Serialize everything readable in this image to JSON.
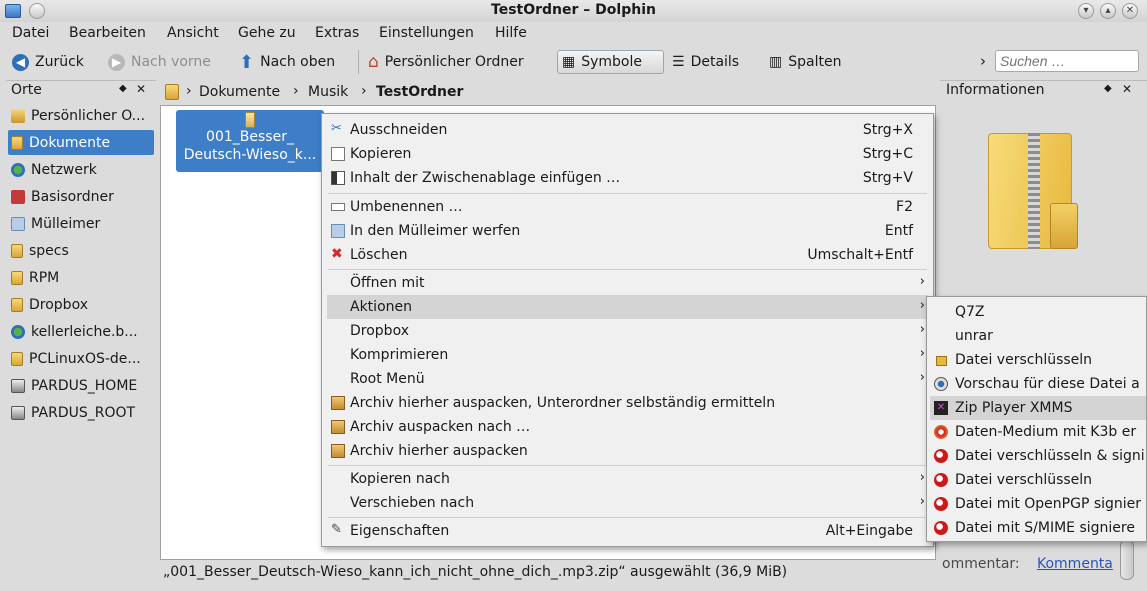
{
  "window": {
    "title": "TestOrdner – Dolphin"
  },
  "menubar": [
    {
      "label": "Datei"
    },
    {
      "label": "Bearbeiten"
    },
    {
      "label": "Ansicht"
    },
    {
      "label": "Gehe zu"
    },
    {
      "label": "Extras"
    },
    {
      "label": "Einstellungen"
    },
    {
      "label": "Hilfe"
    }
  ],
  "toolbar": {
    "back": "Zurück",
    "forward": "Nach vorne",
    "up": "Nach oben",
    "home": "Persönlicher Ordner",
    "icons": "Symbole",
    "details": "Details",
    "columns": "Spalten",
    "overflow": "›",
    "search_placeholder": "Suchen …"
  },
  "places": {
    "title": "Orte",
    "items": [
      {
        "label": "Persönlicher O..."
      },
      {
        "label": "Dokumente"
      },
      {
        "label": "Netzwerk"
      },
      {
        "label": "Basisordner"
      },
      {
        "label": "Mülleimer"
      },
      {
        "label": "specs"
      },
      {
        "label": "RPM"
      },
      {
        "label": "Dropbox"
      },
      {
        "label": "kellerleiche.b..."
      },
      {
        "label": "PCLinuxOS-de..."
      },
      {
        "label": "PARDUS_HOME"
      },
      {
        "label": "PARDUS_ROOT"
      }
    ]
  },
  "breadcrumb": {
    "items": [
      "Dokumente",
      "Musik"
    ],
    "current": "TestOrdner",
    "separator": "›"
  },
  "file": {
    "line1": "001_Besser_",
    "line2": "Deutsch-Wieso_k..."
  },
  "context_menu": {
    "items": [
      {
        "label": "Ausschneiden",
        "shortcut": "Strg+X"
      },
      {
        "label": "Kopieren",
        "shortcut": "Strg+C"
      },
      {
        "label": "Inhalt der Zwischenablage einfügen …",
        "shortcut": "Strg+V"
      },
      {
        "label": "Umbenennen …",
        "shortcut": "F2"
      },
      {
        "label": "In den Mülleimer werfen",
        "shortcut": "Entf"
      },
      {
        "label": "Löschen",
        "shortcut": "Umschalt+Entf"
      },
      {
        "label": "Öffnen mit"
      },
      {
        "label": "Aktionen"
      },
      {
        "label": "Dropbox"
      },
      {
        "label": "Komprimieren"
      },
      {
        "label": "Root Menü"
      },
      {
        "label": "Archiv hierher auspacken, Unterordner selbständig ermitteln"
      },
      {
        "label": "Archiv auspacken nach …"
      },
      {
        "label": "Archiv hierher auspacken"
      },
      {
        "label": "Kopieren nach"
      },
      {
        "label": "Verschieben nach"
      },
      {
        "label": "Eigenschaften",
        "shortcut": "Alt+Eingabe"
      }
    ],
    "arrow": "›"
  },
  "submenu": {
    "items": [
      {
        "label": "Q7Z"
      },
      {
        "label": "unrar"
      },
      {
        "label": "Datei verschlüsseln"
      },
      {
        "label": "Vorschau für diese Datei a"
      },
      {
        "label": "Zip Player XMMS"
      },
      {
        "label": "Daten-Medium mit K3b er"
      },
      {
        "label": "Datei verschlüsseln & signi"
      },
      {
        "label": "Datei verschlüsseln"
      },
      {
        "label": "Datei mit OpenPGP signier"
      },
      {
        "label": "Datei mit S/MIME signiere"
      }
    ]
  },
  "info_panel": {
    "title": "Informationen",
    "comment_label": "ommentar:",
    "comment_link": "Kommenta"
  },
  "status": {
    "text": "„001_Besser_Deutsch-Wieso_kann_ich_nicht_ohne_dich_.mp3.zip“ ausgewählt (36,9 MiB)"
  }
}
